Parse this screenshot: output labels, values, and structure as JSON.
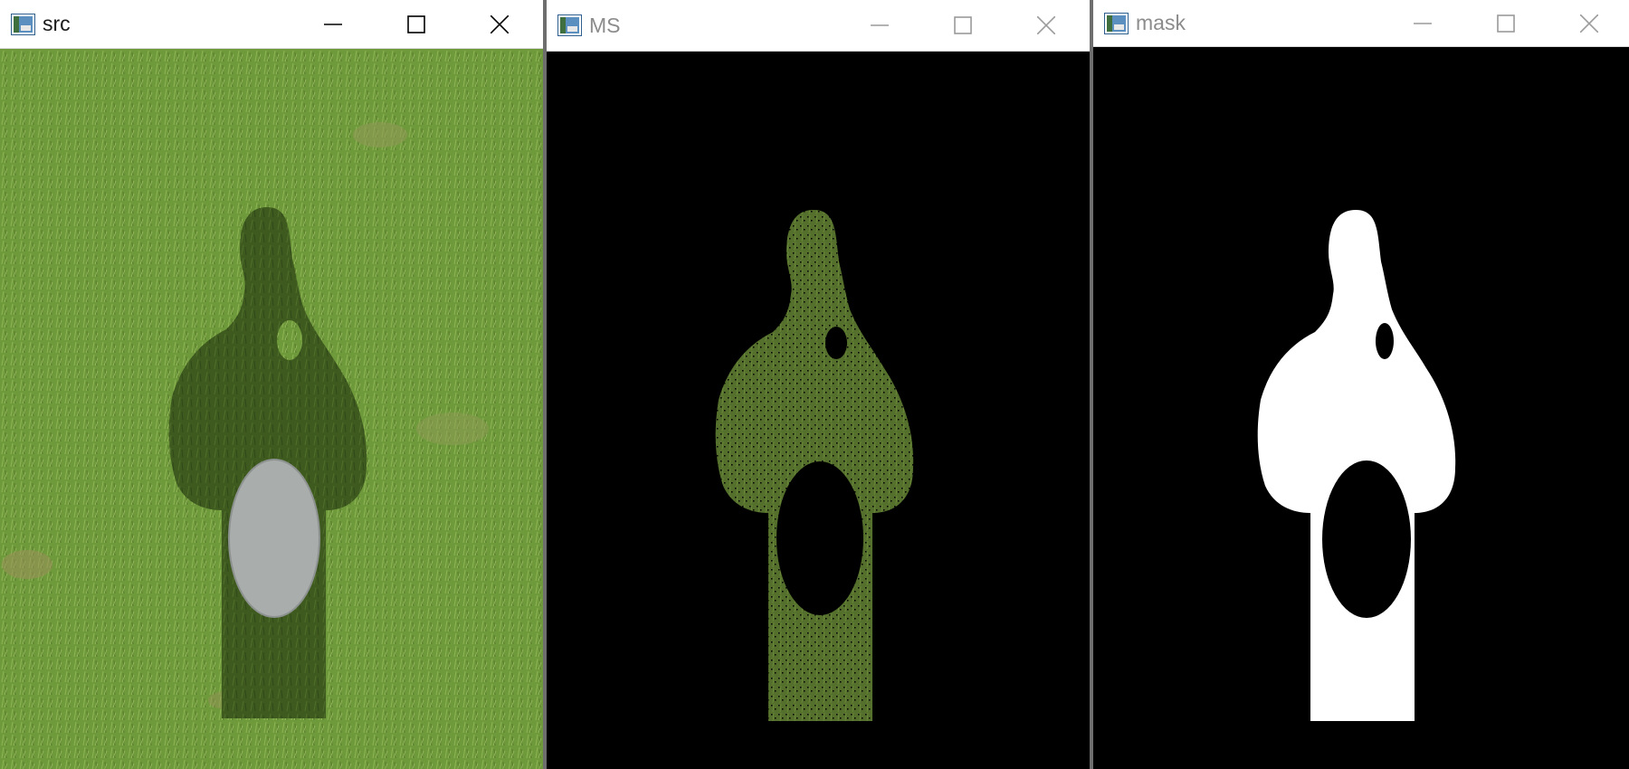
{
  "windows": [
    {
      "id": "src",
      "title": "src",
      "state": "active"
    },
    {
      "id": "ms",
      "title": "MS",
      "state": "inactive"
    },
    {
      "id": "mask",
      "title": "mask",
      "state": "inactive"
    }
  ],
  "icons": {
    "app": "opencv-window-icon",
    "minimize": "minimize-icon",
    "maximize": "maximize-icon",
    "close": "close-icon"
  },
  "colors": {
    "titlebar": "#ffffff",
    "grass": "#6f9a3c",
    "shadow": "#3e5a1e",
    "ms_green": "#54702c",
    "background": "#000000",
    "mask_white": "#ffffff",
    "disc": "#a9adab"
  }
}
